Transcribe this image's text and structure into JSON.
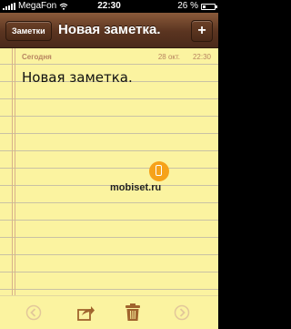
{
  "status_bar": {
    "carrier": "MegaFon",
    "time": "22:30",
    "battery": "26 %",
    "battery_level": 0.26
  },
  "nav": {
    "back_label": "Заметки",
    "title": "Новая заметка.",
    "add_label": "+"
  },
  "note": {
    "date_label": "Сегодня",
    "date": "28 окт.",
    "time": "22:30",
    "text": "Новая заметка."
  },
  "watermark": {
    "text": "mobiset.ru"
  },
  "toolbar": {
    "icons": [
      "previous-icon",
      "share-icon",
      "trash-icon",
      "next-icon"
    ]
  }
}
